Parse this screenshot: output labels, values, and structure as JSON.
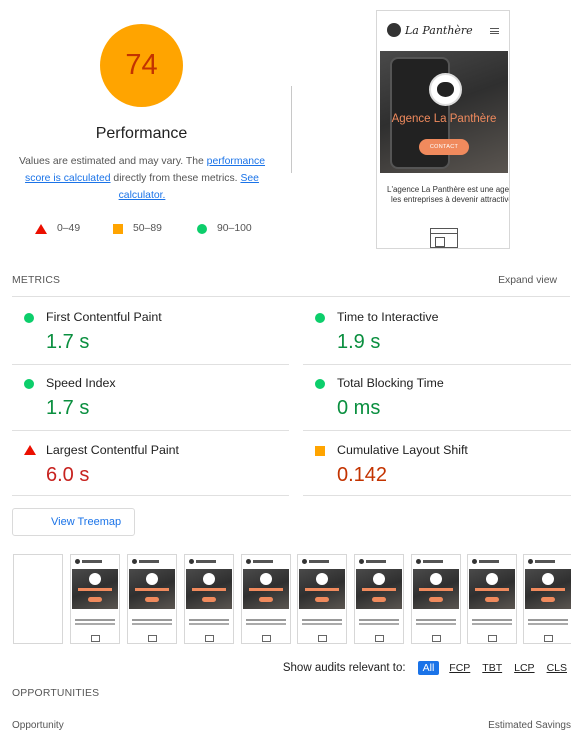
{
  "score": {
    "value": "74",
    "title": "Performance"
  },
  "description": {
    "before": "Values are estimated and may vary. The ",
    "link1": "performance score is calculated",
    "middle": " directly from these metrics. ",
    "link2": "See calculator."
  },
  "legend": [
    {
      "range": "0–49",
      "shape": "triangle",
      "color": "#eb0f00"
    },
    {
      "range": "50–89",
      "shape": "square",
      "color": "#ffa400"
    },
    {
      "range": "90–100",
      "shape": "circle",
      "color": "#0cce6b"
    }
  ],
  "final_screenshot": {
    "logo_text": "La Panthère",
    "hero_title": "Agence La Panthère",
    "button_label": "CONTACT",
    "body_line1": "L'agence La Panthère est une agen",
    "body_line2": "les entreprises à devenir attractive"
  },
  "metrics_section": {
    "label": "METRICS",
    "expand": "Expand view",
    "items": [
      {
        "label": "First Contentful Paint",
        "value": "1.7 s",
        "rating": "good"
      },
      {
        "label": "Time to Interactive",
        "value": "1.9 s",
        "rating": "good"
      },
      {
        "label": "Speed Index",
        "value": "1.7 s",
        "rating": "good"
      },
      {
        "label": "Total Blocking Time",
        "value": "0 ms",
        "rating": "good"
      },
      {
        "label": "Largest Contentful Paint",
        "value": "6.0 s",
        "rating": "bad"
      },
      {
        "label": "Cumulative Layout Shift",
        "value": "0.142",
        "rating": "average"
      }
    ]
  },
  "treemap_button": "View Treemap",
  "filter": {
    "label": "Show audits relevant to:",
    "chips": [
      "All",
      "FCP",
      "TBT",
      "LCP",
      "CLS"
    ],
    "active": "All"
  },
  "opportunities": {
    "label": "OPPORTUNITIES",
    "col_opportunity": "Opportunity",
    "col_savings": "Estimated Savings"
  },
  "colors": {
    "good": "#0a8f3f",
    "bad": "#c7221f",
    "average": "#c33300",
    "link": "#1a73e8"
  }
}
